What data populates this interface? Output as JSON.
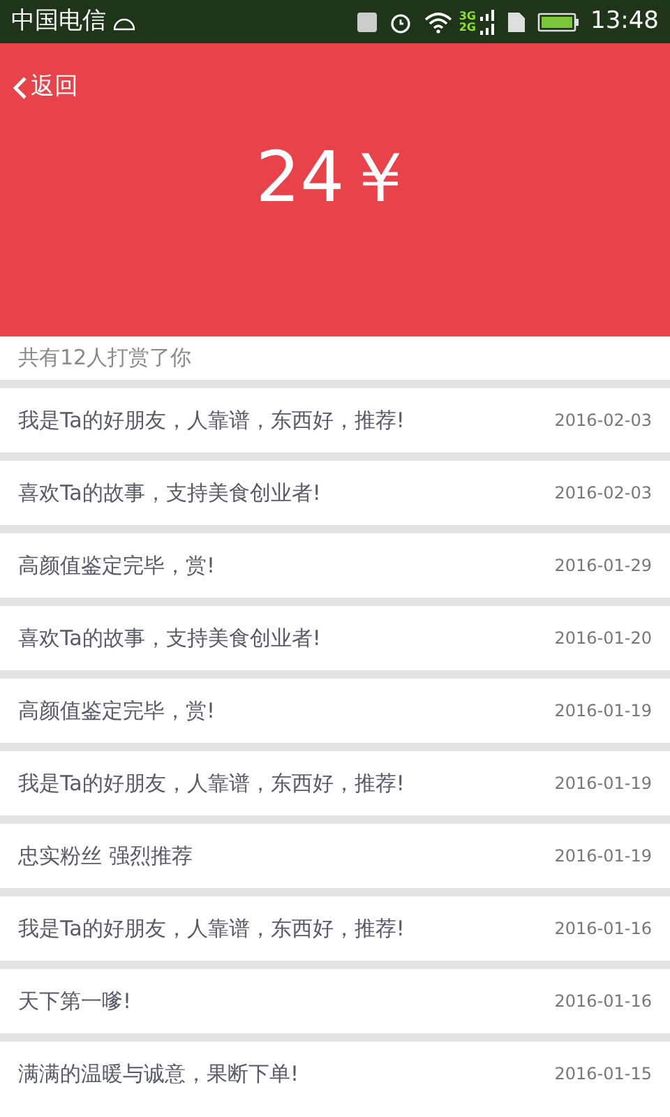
{
  "status_bar": {
    "carrier": "中国电信",
    "network_labels": [
      "3G",
      "2G"
    ],
    "time": "13:48"
  },
  "header": {
    "back": "返回",
    "amount": "24￥"
  },
  "summary": "共有12人打赏了你",
  "rewards": [
    {
      "message": "我是Ta的好朋友，人靠谱，东西好，推荐!",
      "date": "2016-02-03"
    },
    {
      "message": "喜欢Ta的故事，支持美食创业者!",
      "date": "2016-02-03"
    },
    {
      "message": "高颜值鉴定完毕，赏!",
      "date": "2016-01-29"
    },
    {
      "message": "喜欢Ta的故事，支持美食创业者!",
      "date": "2016-01-20"
    },
    {
      "message": "高颜值鉴定完毕，赏!",
      "date": "2016-01-19"
    },
    {
      "message": "我是Ta的好朋友，人靠谱，东西好，推荐!",
      "date": "2016-01-19"
    },
    {
      "message": "忠实粉丝 强烈推荐",
      "date": "2016-01-19"
    },
    {
      "message": "我是Ta的好朋友，人靠谱，东西好，推荐!",
      "date": "2016-01-16"
    },
    {
      "message": "天下第一嗲!",
      "date": "2016-01-16"
    },
    {
      "message": "满满的温暖与诚意，果断下单!",
      "date": "2016-01-15"
    }
  ]
}
